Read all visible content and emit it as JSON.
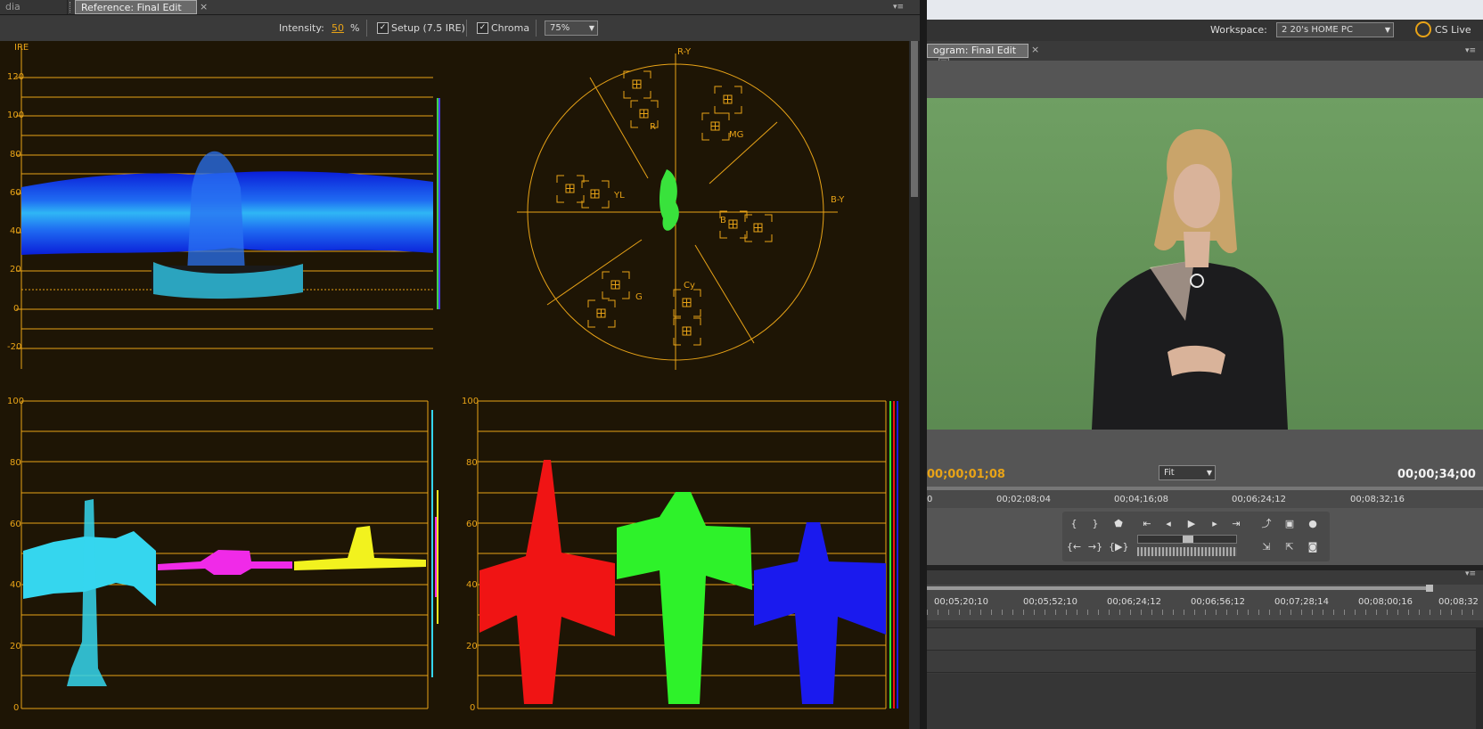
{
  "reference_panel": {
    "tabs": [
      {
        "label": "dia Browser"
      },
      {
        "label": "Reference: Final Edit"
      }
    ],
    "toolbar": {
      "intensity_label": "Intensity:",
      "intensity_value": "50",
      "intensity_unit": "%",
      "setup_label": "Setup (7.5 IRE)",
      "chroma_label": "Chroma",
      "zoom_value": "75%"
    },
    "waveform": {
      "unit_label": "IRE",
      "ticks": [
        "120",
        "100",
        "80",
        "60",
        "40",
        "20",
        "0",
        "-20"
      ]
    },
    "vectorscope": {
      "labels": {
        "ry": "R-Y",
        "by": "B-Y",
        "r": "R",
        "mg": "MG",
        "yl": "YL",
        "b": "B",
        "g": "G",
        "cy": "Cy"
      }
    },
    "ycbcr_parade": {
      "ticks": [
        "100",
        "80",
        "60",
        "40",
        "20",
        "0"
      ]
    },
    "rgb_parade": {
      "ticks": [
        "100",
        "80",
        "60",
        "40",
        "20",
        "0"
      ]
    }
  },
  "workspace": {
    "label": "Workspace:",
    "value": "2 20's HOME PC",
    "cslive": "CS Live"
  },
  "program_monitor": {
    "tab_label": "ogram: Final Edit",
    "current_timecode": "00;00;01;08",
    "fit_value": "Fit",
    "duration_timecode": "00;00;34;00",
    "ruler_labels": [
      "0",
      "00;02;08;04",
      "00;04;16;08",
      "00;06;24;12",
      "00;08;32;16"
    ]
  },
  "timeline": {
    "ruler_labels": [
      "00;05;20;10",
      "00;05;52;10",
      "00;06;24;12",
      "00;06;56;12",
      "00;07;28;14",
      "00;08;00;16",
      "00;08;32"
    ]
  },
  "colors": {
    "scope_line": "#e8a317",
    "scope_bg": "#1e1505",
    "timecode": "#e8a317"
  }
}
